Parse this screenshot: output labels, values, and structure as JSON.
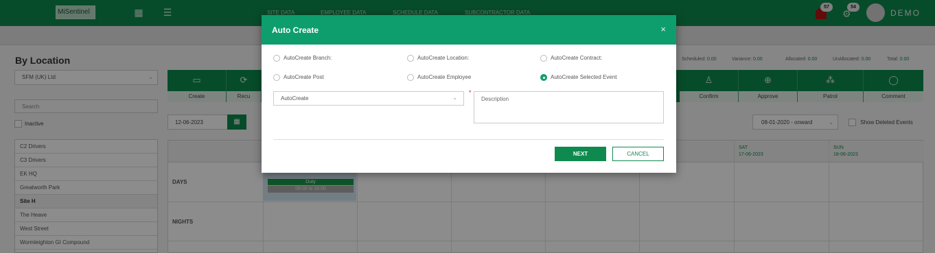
{
  "header": {
    "logo_text": "MiSentinel",
    "nav": [
      "SITE DATA",
      "EMPLOYEE DATA",
      "SCHEDULE DATA",
      "SUBCONTRACTOR DATA"
    ],
    "bell_badge": "57",
    "gear_badge": "54",
    "user": "DEMO",
    "colors": {
      "primary": "#0e8a4e",
      "modal_header": "#0e9e6e",
      "alert": "#b51515"
    }
  },
  "left": {
    "title": "By Location",
    "company_select": "SFM (UK) Ltd",
    "search_placeholder": "Search",
    "inactive_label": "Inactive",
    "sites": [
      "C2 Drivers",
      "C3 Drivers",
      "EK HQ",
      "Greatworth Park",
      "Site H",
      "The Heave",
      "West Street",
      "Wormleighton GI Compound"
    ],
    "selected_site": "Site H"
  },
  "stats": {
    "scheduled_label": "Scheduled:",
    "scheduled": "0.00",
    "variance_label": "Variance:",
    "variance": "0.00",
    "allocated_label": "Allocated:",
    "allocated": "0.00",
    "unallocated_label": "UnAllocated:",
    "unallocated": "0.00",
    "total_label": "Total:",
    "total": "0.00"
  },
  "actions": [
    "Create",
    "Recu",
    "Confirm",
    "Approve",
    "Patrol",
    "Comment"
  ],
  "toolbar": {
    "date": "12-06-2023",
    "range": "08-01-2020 - onward",
    "show_deleted": "Show Deleted Events"
  },
  "schedule": {
    "rows": [
      "DAYS",
      "NIGHTS"
    ],
    "days": [
      {
        "name": "SAT",
        "date": "17-06-2023"
      },
      {
        "name": "SUN",
        "date": "18-06-2023"
      }
    ],
    "event": {
      "label": "Duty",
      "time": "08:00 to 18:00"
    }
  },
  "modal": {
    "title": "Auto Create",
    "close": "×",
    "options": [
      {
        "label": "AutoCreate Branch:",
        "selected": false
      },
      {
        "label": "AutoCreate Location:",
        "selected": false
      },
      {
        "label": "AutoCreate Contract:",
        "selected": false
      },
      {
        "label": "AutoCreate Post",
        "selected": false
      },
      {
        "label": "AutoCreate Employee",
        "selected": false
      },
      {
        "label": "AutoCreate Selected Event",
        "selected": true
      }
    ],
    "select_value": "AutoCreate",
    "required_marker": "*",
    "description_placeholder": "Description",
    "next_label": "NEXT",
    "cancel_label": "CANCEL"
  }
}
